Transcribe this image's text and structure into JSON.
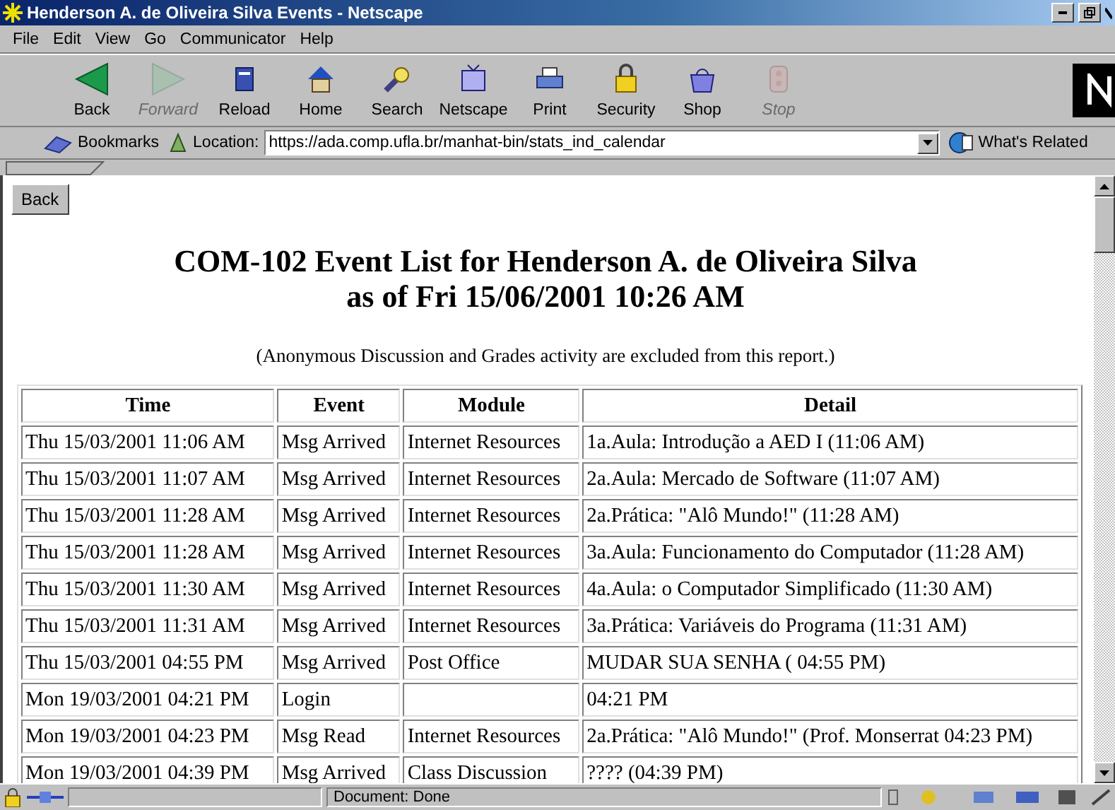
{
  "window": {
    "title": "Henderson A. de Oliveira Silva Events - Netscape"
  },
  "menu": [
    "File",
    "Edit",
    "View",
    "Go",
    "Communicator",
    "Help"
  ],
  "toolbar": [
    {
      "label": "Back",
      "kind": "back",
      "disabled": false
    },
    {
      "label": "Forward",
      "kind": "forward",
      "disabled": true
    },
    {
      "label": "Reload",
      "kind": "reload",
      "disabled": false
    },
    {
      "label": "Home",
      "kind": "home",
      "disabled": false
    },
    {
      "label": "Search",
      "kind": "search",
      "disabled": false
    },
    {
      "label": "Netscape",
      "kind": "netscape",
      "disabled": false
    },
    {
      "label": "Print",
      "kind": "print",
      "disabled": false
    },
    {
      "label": "Security",
      "kind": "security",
      "disabled": false
    },
    {
      "label": "Shop",
      "kind": "shop",
      "disabled": false
    },
    {
      "label": "Stop",
      "kind": "stop",
      "disabled": true
    }
  ],
  "location_bar": {
    "bookmarks": "Bookmarks",
    "label": "Location:",
    "url": "https://ada.comp.ufla.br/manhat-bin/stats_ind_calendar",
    "related": "What's Related"
  },
  "page": {
    "back_button": "Back",
    "heading": [
      "COM-102 Event List for Henderson A. de Oliveira Silva",
      "as of Fri 15/06/2001 10:26 AM"
    ],
    "note": "(Anonymous Discussion and Grades activity are excluded from this report.)",
    "table": {
      "columns": [
        "Time",
        "Event",
        "Module",
        "Detail"
      ],
      "rows": [
        [
          "Thu 15/03/2001 11:06 AM",
          "Msg Arrived",
          "Internet Resources",
          "1a.Aula: Introdução a AED I (11:06 AM)"
        ],
        [
          "Thu 15/03/2001 11:07 AM",
          "Msg Arrived",
          "Internet Resources",
          "2a.Aula: Mercado de Software (11:07 AM)"
        ],
        [
          "Thu 15/03/2001 11:28 AM",
          "Msg Arrived",
          "Internet Resources",
          "2a.Prática: \"Alô Mundo!\" (11:28 AM)"
        ],
        [
          "Thu 15/03/2001 11:28 AM",
          "Msg Arrived",
          "Internet Resources",
          "3a.Aula: Funcionamento do Computador (11:28 AM)"
        ],
        [
          "Thu 15/03/2001 11:30 AM",
          "Msg Arrived",
          "Internet Resources",
          "4a.Aula: o Computador Simplificado (11:30 AM)"
        ],
        [
          "Thu 15/03/2001 11:31 AM",
          "Msg Arrived",
          "Internet Resources",
          "3a.Prática: Variáveis do Programa (11:31 AM)"
        ],
        [
          "Thu 15/03/2001 04:55 PM",
          "Msg Arrived",
          "Post Office",
          "MUDAR SUA SENHA ( 04:55 PM)"
        ],
        [
          "Mon 19/03/2001 04:21 PM",
          "Login",
          "",
          "04:21 PM"
        ],
        [
          "Mon 19/03/2001 04:23 PM",
          "Msg Read",
          "Internet Resources",
          "2a.Prática: \"Alô Mundo!\" (Prof. Monserrat 04:23 PM)"
        ],
        [
          "Mon 19/03/2001 04:39 PM",
          "Msg Arrived",
          "Class Discussion",
          "???? (04:39 PM)"
        ]
      ]
    }
  },
  "status_bar": {
    "text": "Document: Done"
  }
}
